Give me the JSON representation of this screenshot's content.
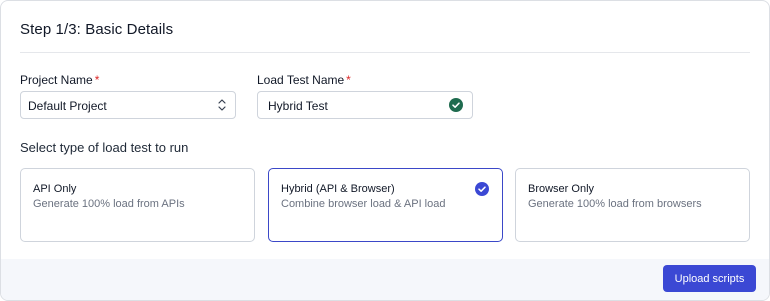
{
  "header": {
    "title": "Step 1/3: Basic Details"
  },
  "project": {
    "label": "Project Name",
    "required_mark": "*",
    "value": "Default Project",
    "icon": "chevron-up-down-icon"
  },
  "test_name": {
    "label": "Load Test Name",
    "required_mark": "*",
    "value": "Hybrid Test",
    "icon": "check-circle-icon"
  },
  "test_type": {
    "label": "Select type of load test to run",
    "options": [
      {
        "title": "API Only",
        "description": "Generate 100% load from APIs",
        "selected": false
      },
      {
        "title": "Hybrid (API & Browser)",
        "description": "Combine browser load & API load",
        "selected": true
      },
      {
        "title": "Browser Only",
        "description": "Generate 100% load from browsers",
        "selected": false
      }
    ]
  },
  "footer": {
    "upload_label": "Upload scripts"
  },
  "colors": {
    "accent": "#3b48d4",
    "valid": "#1f6b4f",
    "required": "#dc2626"
  }
}
